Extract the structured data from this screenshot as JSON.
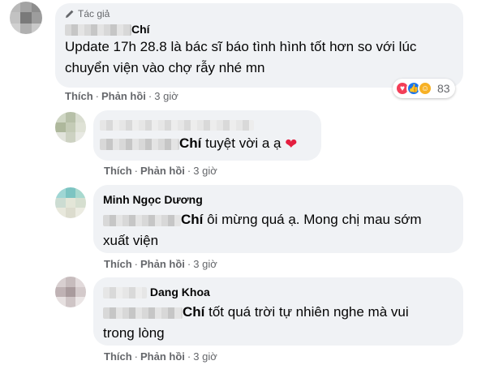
{
  "accent": "#1877f2",
  "comments": [
    {
      "author_badge": "Tác giả",
      "author_suffix": "Chí",
      "line1": "Update 17h 28.8 là bác sĩ báo tình hình tốt hơn so với lúc",
      "line2": "chuyển viện vào chợ rẫy nhé mn",
      "reaction_count": "83",
      "like": "Thích",
      "reply": "Phản hồi",
      "time": "3 giờ"
    },
    {
      "mention": "Chí",
      "text": " tuyệt vời a ạ",
      "emoji": "heart-emoji",
      "like": "Thích",
      "reply": "Phản hồi",
      "time": "3 giờ"
    },
    {
      "author": "Minh Ngọc Dương",
      "mention": "Chí",
      "text_line1": " ôi mừng quá ạ. Mong chị mau sớm",
      "text_line2": "xuất viện",
      "like": "Thích",
      "reply": "Phản hồi",
      "time": "3 giờ"
    },
    {
      "author": "Dang Khoa",
      "mention": "Chí",
      "text_line1": " tốt quá trời tự nhiên nghe mà vui",
      "text_line2": "trong lòng",
      "like": "Thích",
      "reply": "Phản hồi",
      "time": "3 giờ"
    }
  ],
  "icons": [
    "pencil-icon",
    "love-reaction-icon",
    "like-reaction-icon",
    "care-reaction-icon"
  ]
}
